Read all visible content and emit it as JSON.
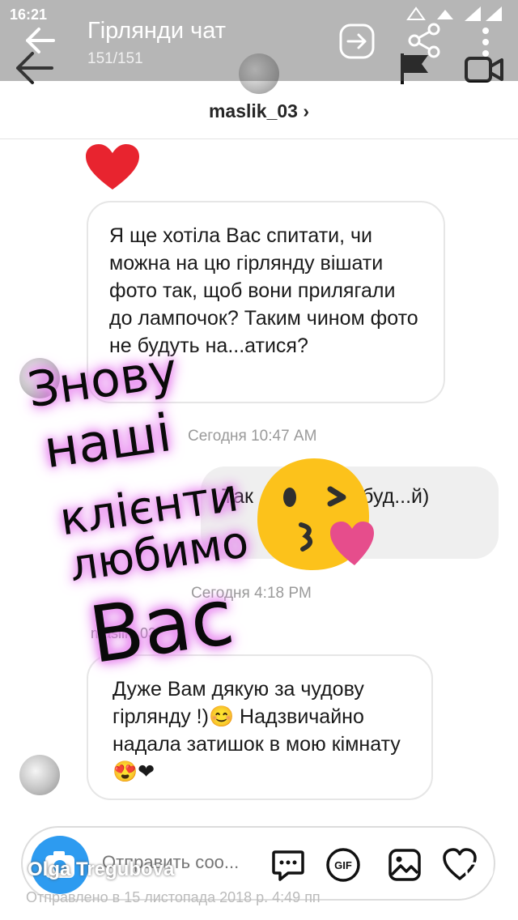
{
  "status_bar": {
    "time": "16:21"
  },
  "outer_header": {
    "title": "Гірлянди чат",
    "counter": "151/151"
  },
  "chat_header": {
    "username": "maslik_03"
  },
  "messages": {
    "m1": "Я ще хотіла Вас спитати, чи можна на цю гірлянду вішати фото так, щоб вони прилягали до лампочок? Таким чином фото не будуть на...атися?",
    "ts1": "Сегодня 10:47 AM",
    "m2": "Так ...атися не буд...й)",
    "ts2": "Сегодня 4:18 PM",
    "sender": "maslik_03",
    "m3": "Дуже Вам дякую за чудову гірлянду !)😊  Надзвичайно надала затишок в мою кімнату😍❤"
  },
  "composer": {
    "placeholder": "Отправить соо..."
  },
  "footer": {
    "owner": "Olga Tregubova",
    "status": "Отправлено в 15 листопада 2018 р. 4:49 пп"
  },
  "sticker": {
    "line1": "Знову",
    "line2": "наші",
    "line3": "клієнти",
    "line4": "любимо",
    "line5": "Вас"
  },
  "colors": {
    "sticker_glow": "#e879f0",
    "camera_button": "#2d9bf0",
    "heart": "#e8242f"
  },
  "icons": [
    "back-arrow-icon",
    "forward-icon",
    "share-icon",
    "more-icon",
    "flag-icon",
    "video-icon",
    "camera-icon",
    "message-icon",
    "gif-icon",
    "image-icon",
    "heart-icon",
    "kiss-emoji"
  ]
}
